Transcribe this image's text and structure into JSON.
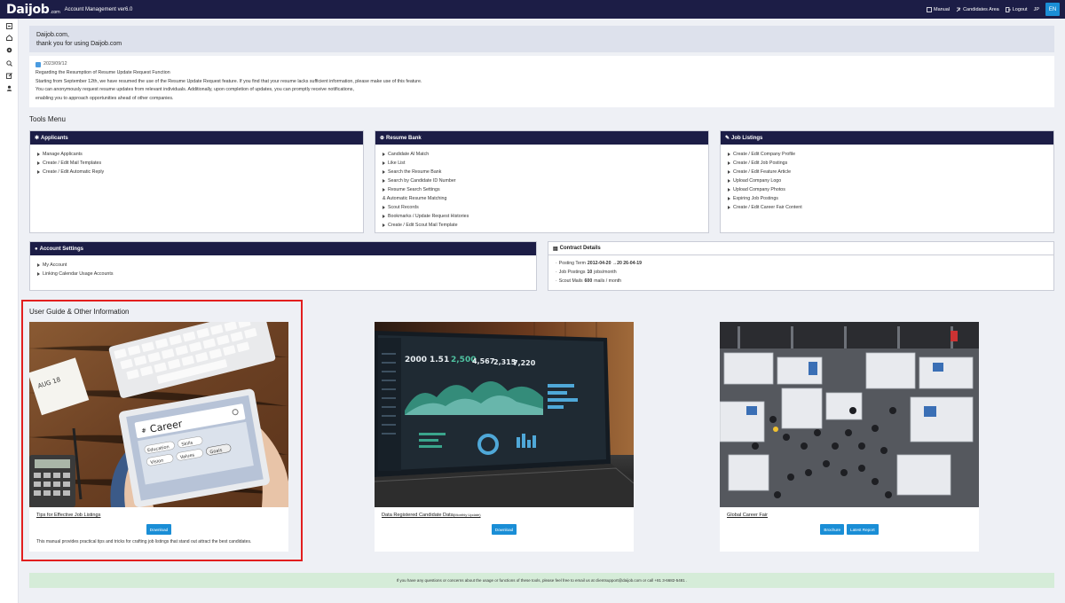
{
  "header": {
    "logo": "Daijob",
    "logo_suffix": ".com",
    "app_title": "Account Management ver6.0",
    "links": {
      "manual": "Manual",
      "candidates_area": "Candidates Area",
      "logout": "Logout"
    },
    "lang_jp": "JP",
    "lang_en": "EN"
  },
  "welcome": {
    "line1": "Daijob.com,",
    "line2": "thank you for using Daijob.com"
  },
  "announcement": {
    "date": "2023/09/12",
    "lines": [
      "Regarding the Resumption of Resume Update Request Function",
      "Starting from September 12th, we have resumed the use of the Resume Update Request feature. If you find that your resume lacks sufficient information, please make use of this feature.",
      "You can anonymously request resume updates from relevant individuals. Additionally, upon completion of updates, you can promptly receive notifications,",
      "enabling you to approach opportunities ahead of other companies."
    ]
  },
  "tools_menu": {
    "title": "Tools Menu",
    "applicants": {
      "title": "Applicants",
      "items": [
        "Manage Applicants",
        "Create / Edit Mail Templates",
        "Create / Edit Automatic Reply"
      ]
    },
    "resume_bank": {
      "title": "Resume Bank",
      "items": [
        "Candidate AI Match",
        "Like List",
        "Search the Resume Bank",
        "Search by Candidate ID Number",
        "Resume Search Settings",
        "& Automatic Resume Matching",
        "Scout Records",
        "Bookmarks / Update Request Histories",
        "Create / Edit Scout Mail Template"
      ]
    },
    "job_listings": {
      "title": "Job Listings",
      "items": [
        "Create / Edit Company Profile",
        "Create / Edit Job Postings",
        "Create / Edit Feature Article",
        "Upload Company Logo",
        "Upload Company Photos",
        "Expiring Job Postings",
        "Create / Edit Career Fair Content"
      ]
    },
    "account_settings": {
      "title": "Account Settings",
      "items": [
        "My Account",
        "Linking Calendar Usage Accounts"
      ]
    },
    "contract": {
      "title": "Contract Details",
      "posting_term_label": "Posting Term",
      "posting_term_value": "2012-04-20 →20 26-04-19",
      "job_postings_label": "Job Postings",
      "job_postings_value": "10",
      "job_postings_unit": "jobs/month",
      "scout_mails_label": "Scout Mails",
      "scout_mails_value": "600",
      "scout_mails_unit": "mails / month"
    }
  },
  "user_guide": {
    "title": "User Guide & Other Information",
    "cards": [
      {
        "title": "Tips for Effective Job Listings",
        "subtitle": "",
        "buttons": [
          "Download"
        ],
        "desc": "This manual provides practical tips and tricks for crafting job listings that stand out attract the best candidates."
      },
      {
        "title": "Data Registered Candidate Data",
        "subtitle": "(Monthly Update)",
        "buttons": [
          "Download"
        ],
        "desc": ""
      },
      {
        "title": "Global Career Fair",
        "subtitle": "",
        "buttons": [
          "Brochure",
          "Latest Report"
        ],
        "desc": ""
      }
    ],
    "image1_text": {
      "career": "Career",
      "tag1": "Education",
      "tag2": "Skills",
      "tag3": "Vision",
      "tag4": "Values",
      "tag5": "Goals",
      "sticky": "AUG 18"
    }
  },
  "footer": {
    "text": "If you have any questions or concerns about the usage or functions of these tools, please feel free to email us at clientsupport@daijob.com or call +81 3-6682-5481 ."
  },
  "colors": {
    "navy": "#1c1d46",
    "accent": "#1a8ed6",
    "highlight": "#e21e1e",
    "footer_bg": "#d5ecd8"
  }
}
